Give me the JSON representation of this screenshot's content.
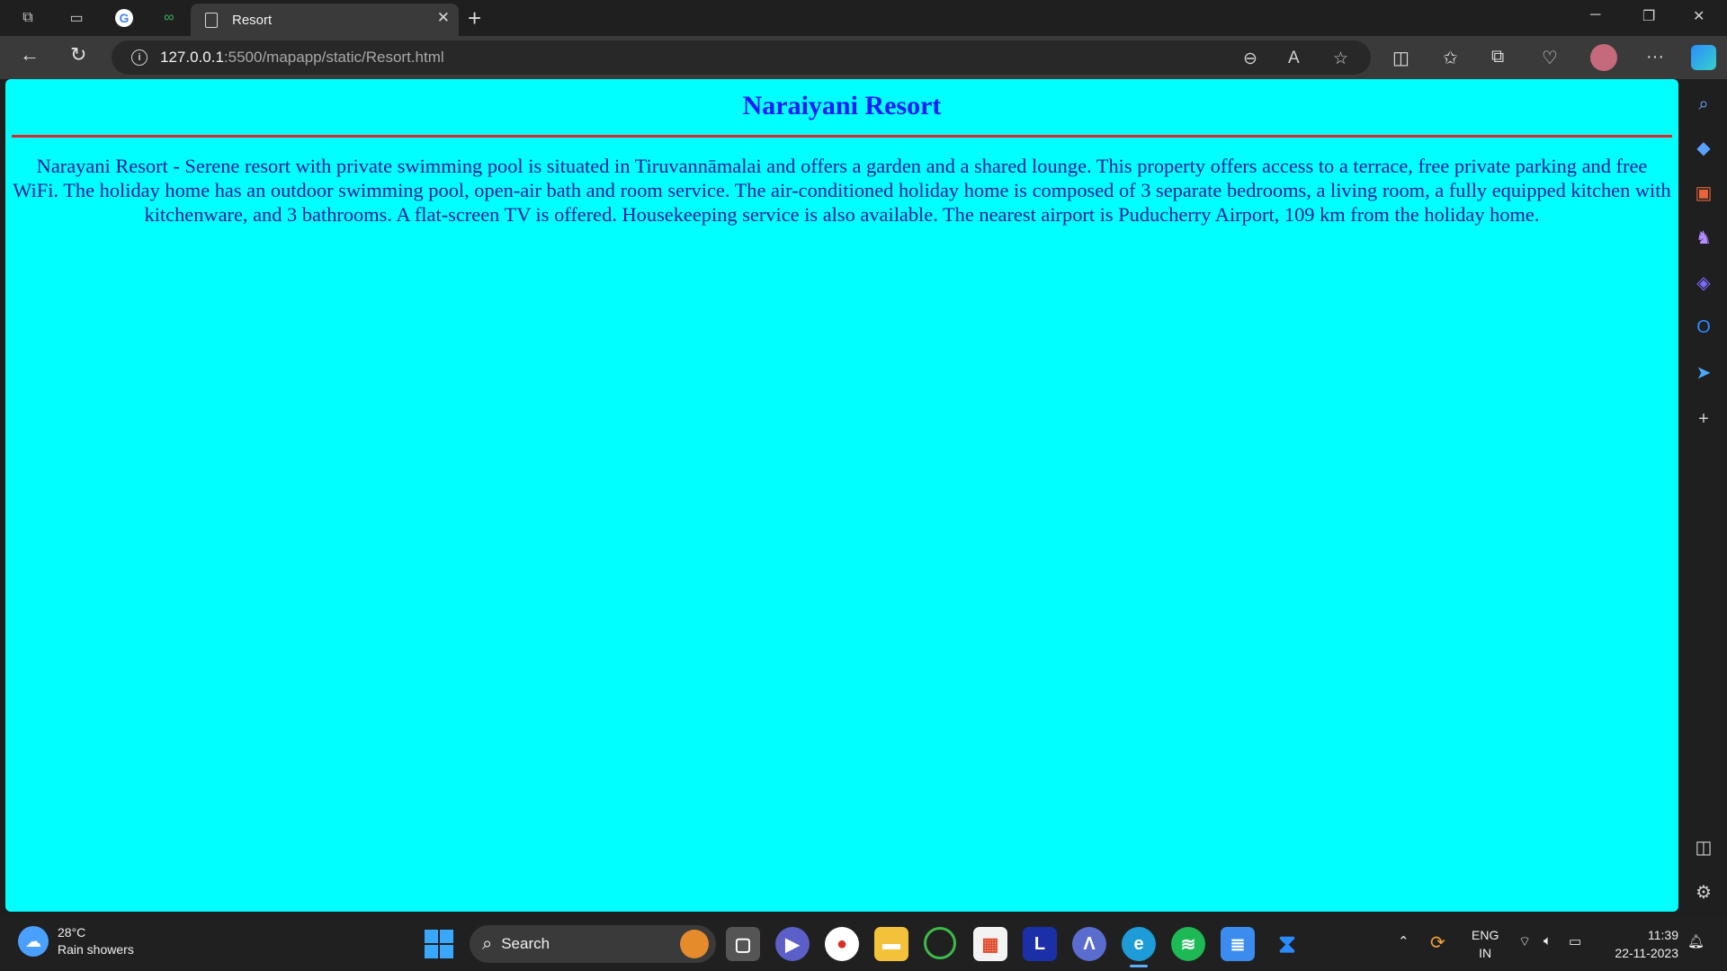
{
  "browser": {
    "active_tab_title": "Resort",
    "url_host": "127.0.0.1",
    "url_rest": ":5500/mapapp/static/Resort.html"
  },
  "page": {
    "title": "Naraiyani Resort",
    "description": "Narayani Resort - Serene resort with private swimming pool is situated in Tiruvannāmalai and offers a garden and a shared lounge. This property offers access to a terrace, free private parking and free WiFi. The holiday home has an outdoor swimming pool, open-air bath and room service. The air-conditioned holiday home is composed of 3 separate bedrooms, a living room, a fully equipped kitchen with kitchenware, and 3 bathrooms. A flat-screen TV is offered. Housekeeping service is also available. The nearest airport is Puducherry Airport, 109 km from the holiday home.",
    "background_color": "#00ffff",
    "title_color": "#1a1aff",
    "rule_color": "#e0262a"
  },
  "taskbar": {
    "weather_temp": "28°C",
    "weather_desc": "Rain showers",
    "search_label": "Search",
    "lang_top": "ENG",
    "lang_bottom": "IN",
    "time": "11:39",
    "date": "22-11-2023"
  }
}
